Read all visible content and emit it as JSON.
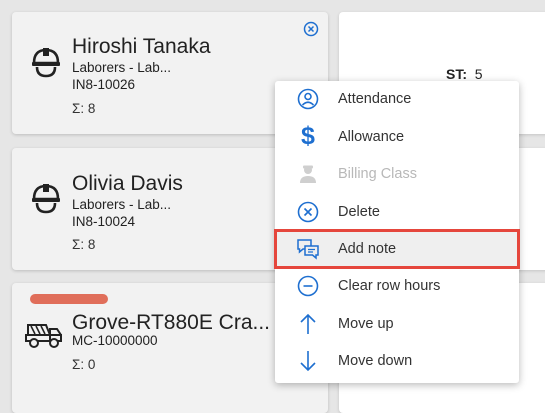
{
  "cards": [
    {
      "name": "Hiroshi Tanaka",
      "line1": "Laborers - Lab...",
      "line2": "IN8-10026",
      "sum": "Σ: 8",
      "icon": "worker-helmet-icon"
    },
    {
      "name": "Olivia Davis",
      "line1": "Laborers - Lab...",
      "line2": "IN8-10024",
      "sum": "Σ: 8",
      "icon": "worker-helmet-icon"
    },
    {
      "name": "Grove-RT880E Cra...",
      "line1": "MC-10000000",
      "sum": "Σ: 0",
      "icon": "dump-truck-icon",
      "status_color": "#e06e5a"
    }
  ],
  "st": {
    "label": "ST:",
    "value": "5"
  },
  "menu": {
    "items": [
      {
        "label": "Attendance",
        "icon": "person-circle-icon"
      },
      {
        "label": "Allowance",
        "icon": "dollar-icon"
      },
      {
        "label": "Billing Class",
        "icon": "worker-badge-icon",
        "disabled": true
      },
      {
        "label": "Delete",
        "icon": "close-circle-icon"
      },
      {
        "label": "Add note",
        "icon": "chat-note-icon",
        "highlighted": true
      },
      {
        "label": "Clear row hours",
        "icon": "minus-circle-icon"
      },
      {
        "label": "Move up",
        "icon": "arrow-up-icon"
      },
      {
        "label": "Move down",
        "icon": "arrow-down-icon"
      }
    ]
  },
  "colors": {
    "accent": "#1e6fd0",
    "highlight_border": "#e5463c",
    "disabled": "#c8c8c8"
  }
}
